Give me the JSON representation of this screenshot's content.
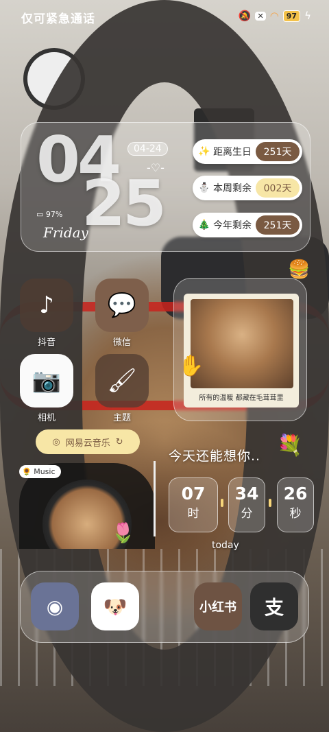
{
  "status_bar": {
    "carrier_text": "仅可紧急通话",
    "battery": "97",
    "icons": [
      "bell-muted-icon",
      "x-box-icon",
      "wifi-icon",
      "battery-icon",
      "charging-icon"
    ]
  },
  "clock_widget": {
    "hour": "04",
    "minute": "25",
    "date": "04-24",
    "weekday": "Friday",
    "battery": "97%",
    "countdowns": [
      {
        "icon": "sparkle-icon",
        "label": "距离生日",
        "value": "251天"
      },
      {
        "icon": "snowman-icon",
        "label": "本周剩余",
        "value": "002天"
      },
      {
        "icon": "tree-icon",
        "label": "今年剩余",
        "value": "251天"
      }
    ]
  },
  "apps": [
    {
      "name": "抖音",
      "icon": "tiktok-icon"
    },
    {
      "name": "微信",
      "icon": "wechat-icon"
    },
    {
      "name": "相机",
      "icon": "camera-icon"
    },
    {
      "name": "主题",
      "icon": "theme-brush-icon"
    }
  ],
  "photo_widget": {
    "caption": "所有的温暖 都藏在毛茸茸里"
  },
  "music_widget": {
    "button_label": "网易云音乐",
    "tag": "Music"
  },
  "slogan": "今天还能想你..",
  "time_widget": {
    "hours": "07",
    "hours_unit": "时",
    "minutes": "34",
    "minutes_unit": "分",
    "seconds": "26",
    "seconds_unit": "秒",
    "label": "today"
  },
  "dock": [
    {
      "icon": "weibo-icon",
      "label": ""
    },
    {
      "icon": "dog-app-icon",
      "label": ""
    },
    {
      "icon": "xiaohongshu-icon",
      "label": "小红书"
    },
    {
      "icon": "alipay-icon",
      "label": "支"
    }
  ],
  "colors": {
    "accent_brown": "#7a5a42",
    "accent_cream": "#f7e6a6"
  }
}
